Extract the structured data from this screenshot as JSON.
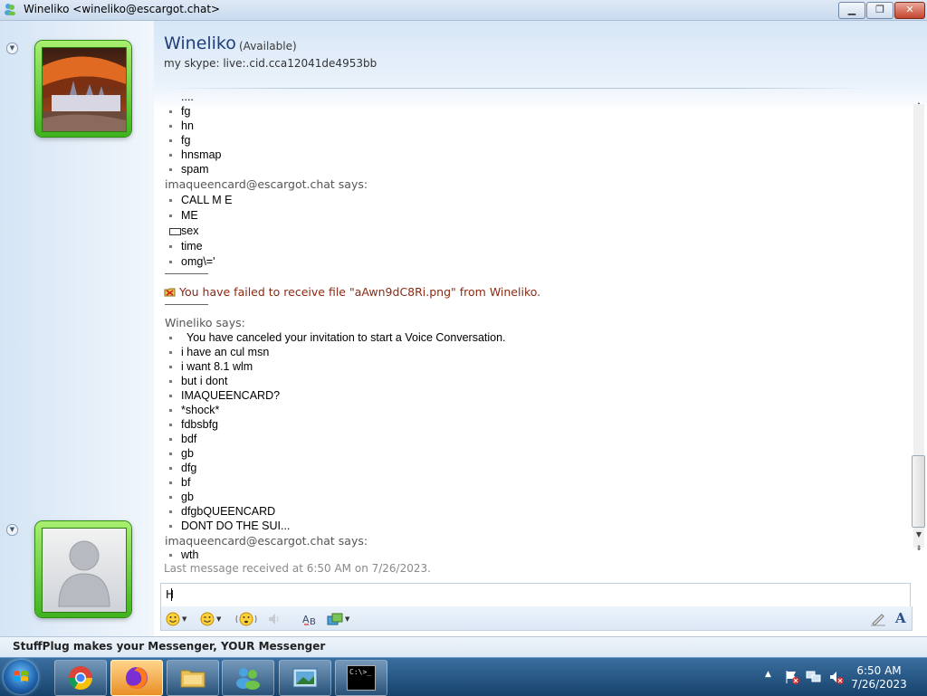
{
  "window": {
    "title": "Wineliko <wineliko@escargot.chat>",
    "minimize_label": "▁",
    "maximize_label": "❐",
    "close_label": "✕"
  },
  "contact": {
    "name": "Wineliko",
    "status": "(Available)",
    "psm": "my skype: live:.cid.cca12041de4953bb"
  },
  "conversation": {
    "messages_a": [
      "....",
      "fg",
      "hn",
      "fg",
      "hnsmap",
      "spam"
    ],
    "sender_1": "imaqueencard@escargot.chat says:",
    "messages_b": [
      "CALL M E",
      "ME"
    ],
    "sex_text": "sex",
    "messages_c": [
      "time",
      "omg\\='"
    ],
    "file_transfer": "You have failed to receive file \"aAwn9dC8Ri.png\" from Wineliko.",
    "sender_2": "Wineliko says:",
    "messages_d": [
      "You have canceled your invitation to start a Voice Conversation.",
      "i have an cul msn",
      "i want 8.1 wlm",
      "but i dont",
      "IMAQUEENCARD?",
      "*shock*",
      "fdbsbfg",
      "bdf",
      "gb",
      "dfg",
      "bf",
      "gb",
      "dfgbQUEENCARD",
      "DONT DO THE SUI..."
    ],
    "sender_3": "imaqueencard@escargot.chat says:",
    "messages_e": [
      "wth"
    ]
  },
  "last_message": "Last message received at 6:50 AM on 7/26/2023.",
  "input": {
    "value": "H"
  },
  "toolbar": {
    "items": [
      "smiley-icon",
      "wink-icon",
      "nudge-icon",
      "voice-clip-icon",
      "spellcheck-icon",
      "background-icon",
      "handwriting-icon",
      "font-icon"
    ],
    "font_label": "A"
  },
  "promo": {
    "text": "StuffPlug makes your Messenger, YOUR Messenger"
  },
  "taskbar": {
    "apps": [
      "chrome",
      "firefox",
      "file-explorer",
      "messenger",
      "screenshot-tool",
      "command-prompt"
    ],
    "cmd_label": "C:\\>_"
  },
  "clock": {
    "time": "6:50 AM",
    "date": "7/26/2023"
  },
  "colors": {
    "accent": "#1f3f7a",
    "file_transfer_text": "#8a2a12",
    "avatar_frame": "#5cc32c"
  }
}
